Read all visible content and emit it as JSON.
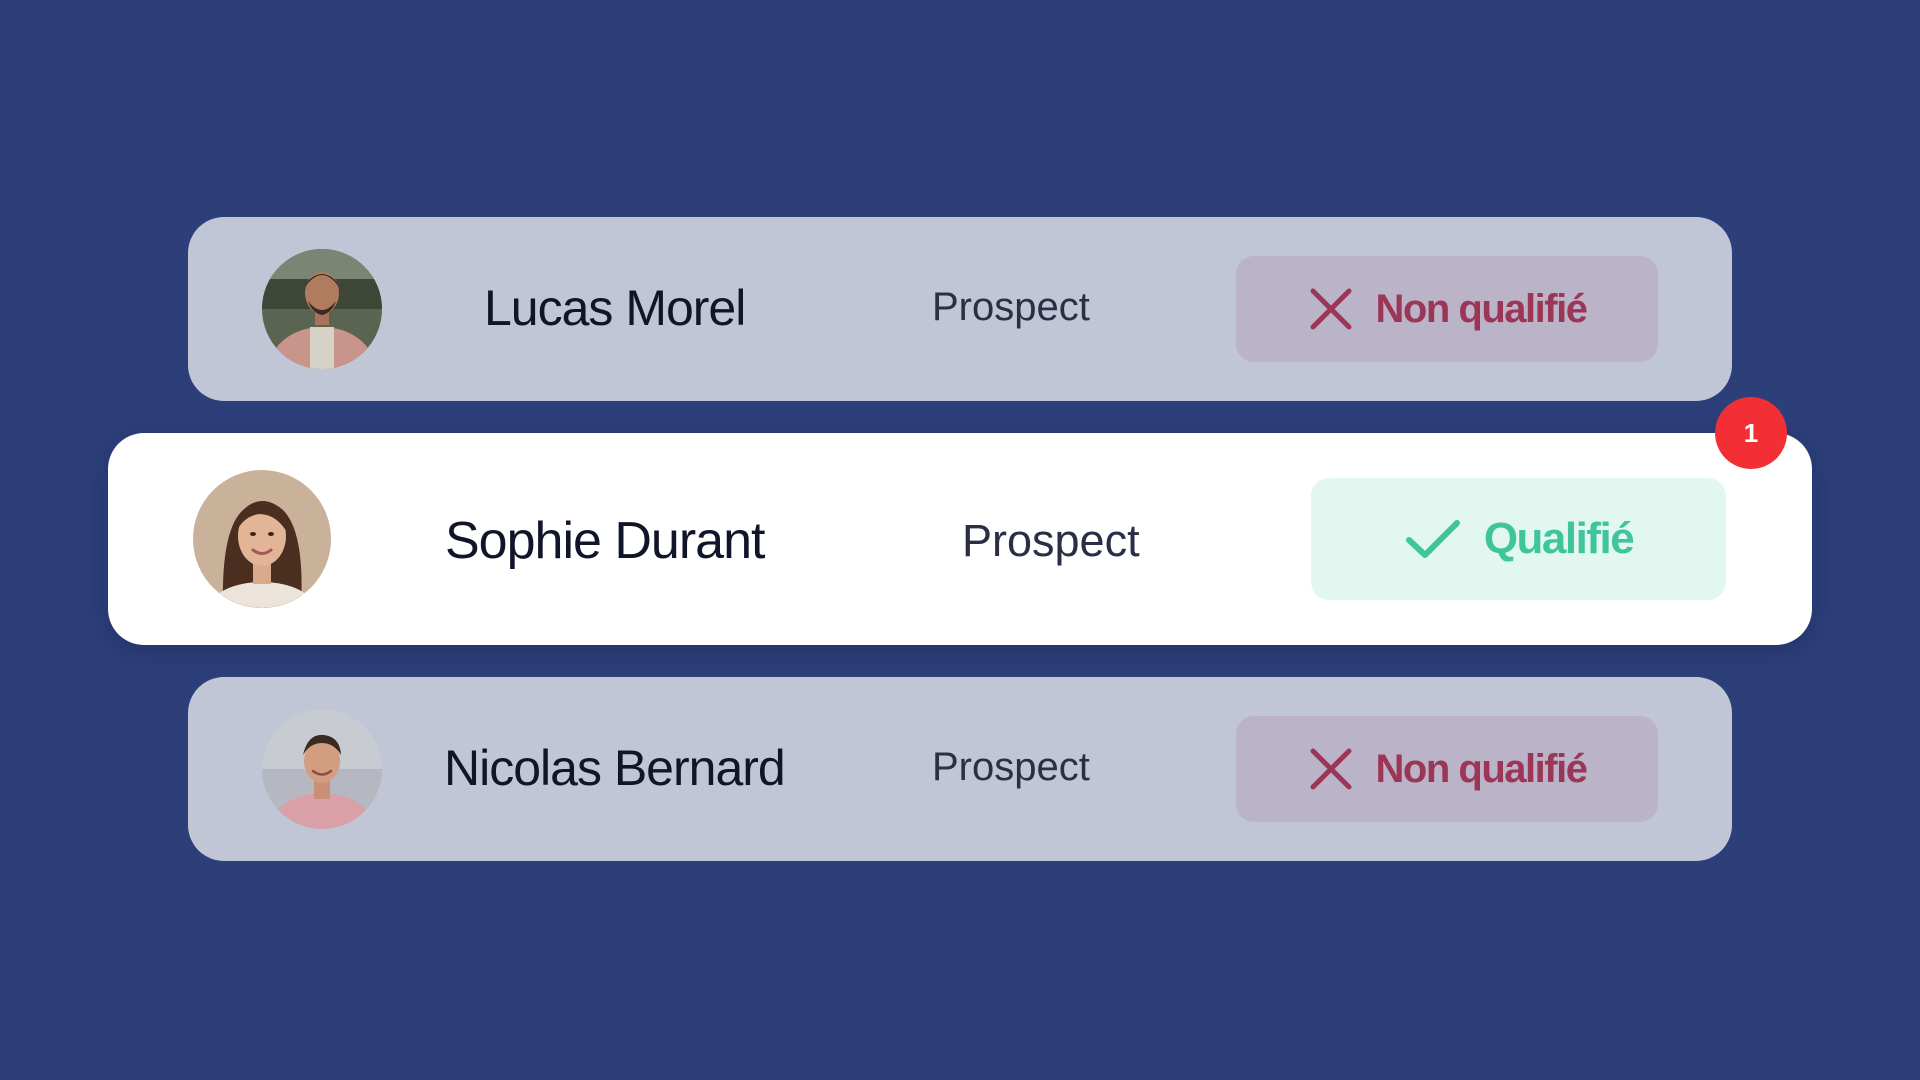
{
  "contacts": [
    {
      "name": "Lucas Morel",
      "role": "Prospect",
      "status": "Non qualifié",
      "status_icon": "x-icon",
      "status_color": "#9c3656"
    },
    {
      "name": "Sophie Durant",
      "role": "Prospect",
      "status": "Qualifié",
      "status_icon": "check-icon",
      "status_color": "#3fc59b",
      "notification_count": "1"
    },
    {
      "name": "Nicolas Bernard",
      "role": "Prospect",
      "status": "Non qualifié",
      "status_icon": "x-icon",
      "status_color": "#9c3656"
    }
  ],
  "colors": {
    "background": "#2c3f79",
    "card_dim": "#c1c6d7",
    "card_active": "#ffffff",
    "badge": "#f22f34"
  }
}
